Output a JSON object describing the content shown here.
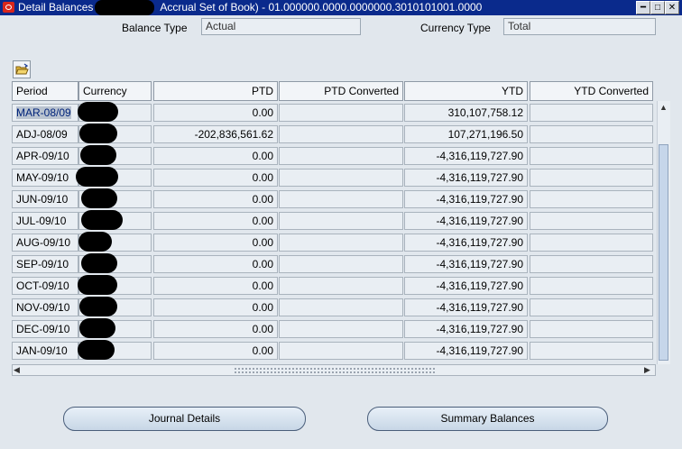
{
  "window": {
    "title_prefix": "Detail Balances",
    "title_suffix": "Accrual Set of Book) - 01.000000.0000.0000000.3010101001.0000",
    "buttons": [
      "minimize",
      "maximize",
      "close"
    ]
  },
  "form": {
    "balance_type_label": "Balance Type",
    "balance_type_value": "Actual",
    "currency_type_label": "Currency Type",
    "currency_type_value": "Total"
  },
  "table": {
    "columns": [
      "Period",
      "Currency",
      "PTD",
      "PTD Converted",
      "YTD",
      "YTD Converted"
    ],
    "rows": [
      {
        "period": "MAR-08/09",
        "ptd": "0.00",
        "ytd": "310,107,758.12",
        "selected": true
      },
      {
        "period": "ADJ-08/09",
        "ptd": "-202,836,561.62",
        "ytd": "107,271,196.50"
      },
      {
        "period": "APR-09/10",
        "ptd": "0.00",
        "ytd": "-4,316,119,727.90"
      },
      {
        "period": "MAY-09/10",
        "ptd": "0.00",
        "ytd": "-4,316,119,727.90"
      },
      {
        "period": "JUN-09/10",
        "ptd": "0.00",
        "ytd": "-4,316,119,727.90"
      },
      {
        "period": "JUL-09/10",
        "ptd": "0.00",
        "ytd": "-4,316,119,727.90"
      },
      {
        "period": "AUG-09/10",
        "ptd": "0.00",
        "ytd": "-4,316,119,727.90"
      },
      {
        "period": "SEP-09/10",
        "ptd": "0.00",
        "ytd": "-4,316,119,727.90"
      },
      {
        "period": "OCT-09/10",
        "ptd": "0.00",
        "ytd": "-4,316,119,727.90"
      },
      {
        "period": "NOV-09/10",
        "ptd": "0.00",
        "ytd": "-4,316,119,727.90"
      },
      {
        "period": "DEC-09/10",
        "ptd": "0.00",
        "ytd": "-4,316,119,727.90"
      },
      {
        "period": "JAN-09/10",
        "ptd": "0.00",
        "ytd": "-4,316,119,727.90"
      }
    ]
  },
  "actions": {
    "journal_details": "Journal Details",
    "summary_balances": "Summary Balances"
  },
  "icons": {
    "folder": "open-folder-icon",
    "minimize": "minimize-icon",
    "maximize": "maximize-icon",
    "close": "close-icon"
  }
}
